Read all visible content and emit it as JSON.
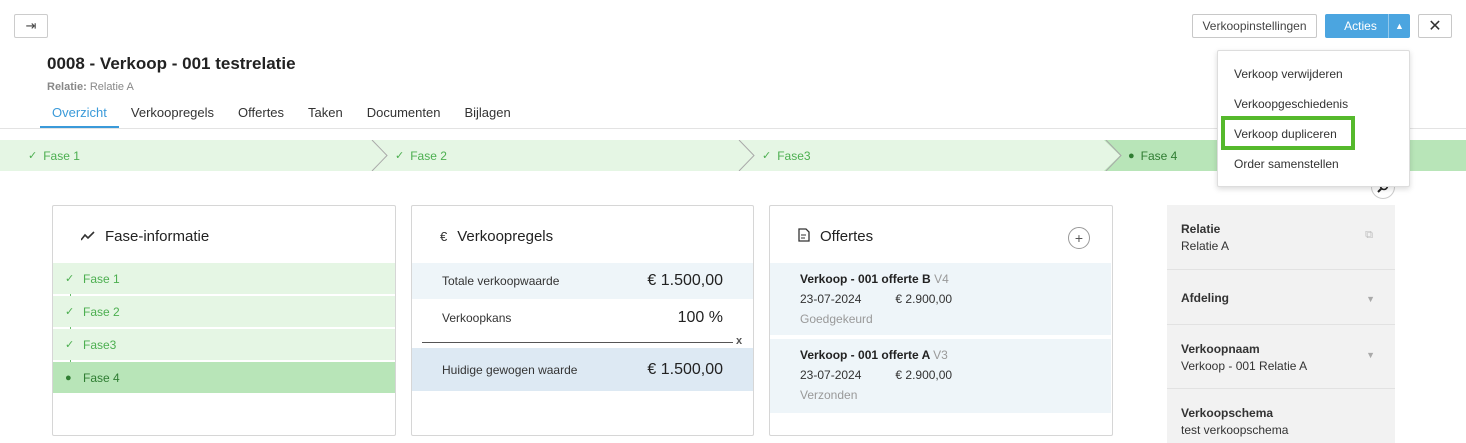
{
  "header": {
    "collapse_icon": "arrow-to-right-icon",
    "settings_label": "Verkoopinstellingen",
    "actions_label": "Acties",
    "close_label": "✕",
    "title": "0008 - Verkoop - 001 testrelatie",
    "relation_label": "Relatie:",
    "relation_value": "Relatie A"
  },
  "tabs": [
    "Overzicht",
    "Verkoopregels",
    "Offertes",
    "Taken",
    "Documenten",
    "Bijlagen"
  ],
  "phases": [
    "Fase 1",
    "Fase 2",
    "Fase3",
    "Fase 4"
  ],
  "actions_menu": [
    "Verkoop verwijderen",
    "Verkoopgeschiedenis",
    "Verkoop dupliceren",
    "Order samenstellen"
  ],
  "fase_card": {
    "title": "Fase-informatie",
    "items": [
      "Fase 1",
      "Fase 2",
      "Fase3",
      "Fase 4"
    ]
  },
  "verkoop_card": {
    "title": "Verkoopregels",
    "total_label": "Totale verkoopwaarde",
    "total_value": "€ 1.500,00",
    "chance_label": "Verkoopkans",
    "chance_value": "100 %",
    "multiply_sign": "x",
    "weighted_label": "Huidige gewogen waarde",
    "weighted_value": "€ 1.500,00"
  },
  "offertes_card": {
    "title": "Offertes",
    "add_label": "+",
    "items": [
      {
        "name": "Verkoop - 001 offerte B",
        "version": "V4",
        "date": "23-07-2024",
        "amount": "€ 2.900,00",
        "status": "Goedgekeurd"
      },
      {
        "name": "Verkoop - 001 offerte A",
        "version": "V3",
        "date": "23-07-2024",
        "amount": "€ 2.900,00",
        "status": "Verzonden"
      }
    ]
  },
  "sidebar": {
    "items": [
      {
        "label": "Relatie",
        "value": "Relatie A"
      },
      {
        "label": "Afdeling",
        "value": ""
      },
      {
        "label": "Verkoopnaam",
        "value": "Verkoop - 001  Relatie A"
      },
      {
        "label": "Verkoopschema",
        "value": "test verkoopschema"
      }
    ]
  },
  "colors": {
    "accent": "#4ba5e0",
    "phase_bg": "#e5f6e4",
    "phase_active": "#b8e5b8",
    "phase_text": "#4caf50",
    "highlight": "#55b92c"
  }
}
